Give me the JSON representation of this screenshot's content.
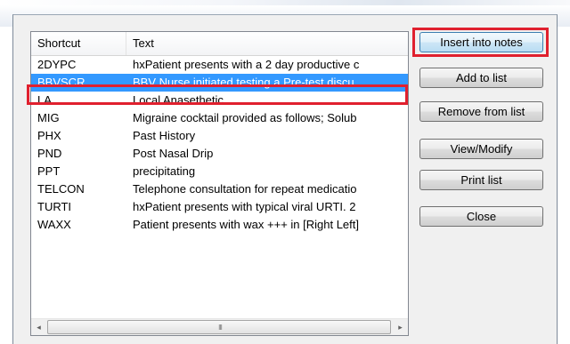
{
  "listview": {
    "columns": [
      "Shortcut",
      "Text"
    ],
    "rows": [
      {
        "shortcut": "2DYPC",
        "text": "hxPatient presents with a 2 day productive c"
      },
      {
        "shortcut": "BBVSCR",
        "text": "BBV Nurse initiated testing   a.Pre-test discu"
      },
      {
        "shortcut": "LA",
        "text": "Local Anasethetic"
      },
      {
        "shortcut": "MIG",
        "text": "Migraine cocktail provided as follows;  Solub"
      },
      {
        "shortcut": "PHX",
        "text": "Past History"
      },
      {
        "shortcut": "PND",
        "text": "Post Nasal Drip"
      },
      {
        "shortcut": "PPT",
        "text": "precipitating"
      },
      {
        "shortcut": "TELCON",
        "text": "Telephone consultation for repeat medicatio"
      },
      {
        "shortcut": "TURTI",
        "text": "hxPatient presents with typical viral URTI. 2"
      },
      {
        "shortcut": "WAXX",
        "text": "Patient presents with wax +++ in [Right Left]"
      }
    ],
    "selected_index": 1,
    "scrollbar": {
      "left_arrow": "◂",
      "right_arrow": "▸",
      "grip": "III"
    }
  },
  "buttons": {
    "insert": "Insert into notes",
    "add": "Add to list",
    "remove": "Remove from list",
    "view": "View/Modify",
    "print": "Print list",
    "close": "Close"
  },
  "colors": {
    "selection": "#3399ff",
    "highlight_outline": "#e0202e",
    "dialog_bg": "#f0f0f0"
  }
}
